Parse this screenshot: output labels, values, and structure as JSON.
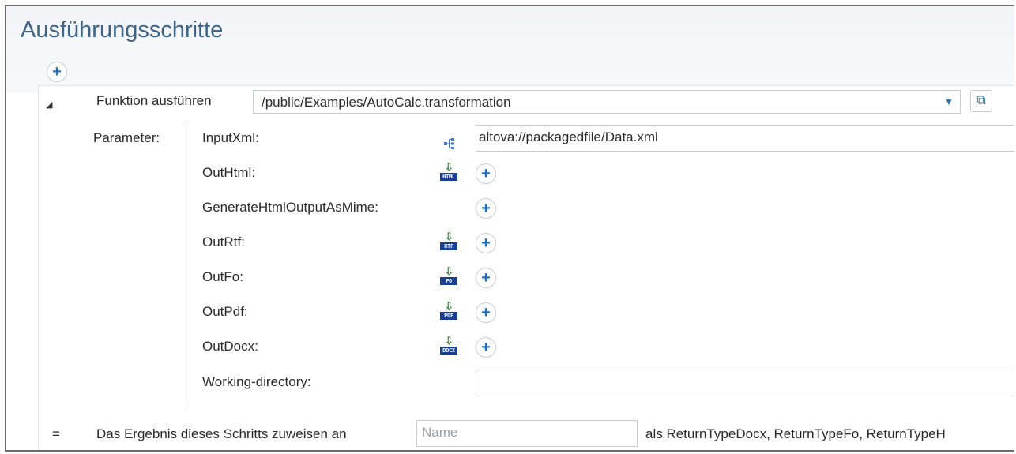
{
  "page": {
    "title": "Ausführungsschritte"
  },
  "step": {
    "function_label": "Funktion ausführen",
    "function_path": "/public/Examples/AutoCalc.transformation",
    "collapse_icon": "triangle-down-icon",
    "open_icon": "external-link-icon",
    "parameters_label": "Parameter:",
    "parameters": [
      {
        "name": "InputXml:",
        "icon": "xml-tree-icon",
        "value": "altova://packagedfile/Data.xml"
      },
      {
        "name": "OutHtml:",
        "icon": "download-html-icon",
        "tag": "HTML"
      },
      {
        "name": "GenerateHtmlOutputAsMime:"
      },
      {
        "name": "OutRtf:",
        "icon": "download-rtf-icon",
        "tag": "RTF"
      },
      {
        "name": "OutFo:",
        "icon": "download-fo-icon",
        "tag": "FO"
      },
      {
        "name": "OutPdf:",
        "icon": "download-pdf-icon",
        "tag": "PDF"
      },
      {
        "name": "OutDocx:",
        "icon": "download-docx-icon",
        "tag": "DOCX"
      },
      {
        "name": "Working-directory:",
        "value": ""
      }
    ],
    "assign": {
      "symbol": "=",
      "label": "Das Ergebnis dieses Schritts zuweisen an",
      "placeholder": "Name",
      "suffix": "als ReturnTypeDocx, ReturnTypeFo, ReturnTypeH"
    }
  },
  "colors": {
    "title": "#3e6487",
    "accent": "#1e6fc2",
    "download_arrow": "#2e8a2e",
    "file_tag": "#1b3f8f"
  }
}
